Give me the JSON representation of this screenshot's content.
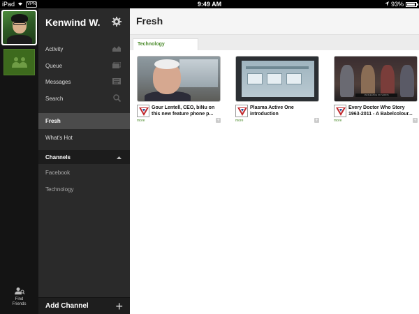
{
  "status_bar": {
    "device": "iPad",
    "vpn": "VPN",
    "time": "9:49 AM",
    "battery": "93%",
    "battery_level": 0.93
  },
  "rail": {
    "find_friends_line1": "Find",
    "find_friends_line2": "Friends"
  },
  "sidebar": {
    "username": "Kenwind W.",
    "nav": [
      {
        "label": "Activity",
        "icon": "activity-chart-icon"
      },
      {
        "label": "Queue",
        "icon": "queue-icon"
      },
      {
        "label": "Messages",
        "icon": "messages-icon"
      },
      {
        "label": "Search",
        "icon": "search-icon"
      }
    ],
    "fresh": "Fresh",
    "whats_hot": "What's Hot",
    "channels_header": "Channels",
    "channels": [
      "Facebook",
      "Technology"
    ],
    "add_channel": "Add Channel"
  },
  "main": {
    "title": "Fresh",
    "active_tab": "Technology",
    "cards": [
      {
        "title": "Gour Lentell, CEO, biNu on this new feature phone p...",
        "more": "more"
      },
      {
        "title": "Plasma Active One introduction",
        "more": "more"
      },
      {
        "title": "Every Doctor Who Story 1963-2011 - A Babelcolour...",
        "more": "more"
      }
    ],
    "thumb3_caption": "VENGEANCE ON VAROS"
  },
  "colors": {
    "accent_green": "#4a8a2a",
    "sidebar_bg": "#2a2a2a",
    "group_tile": "#3d6a1d"
  }
}
